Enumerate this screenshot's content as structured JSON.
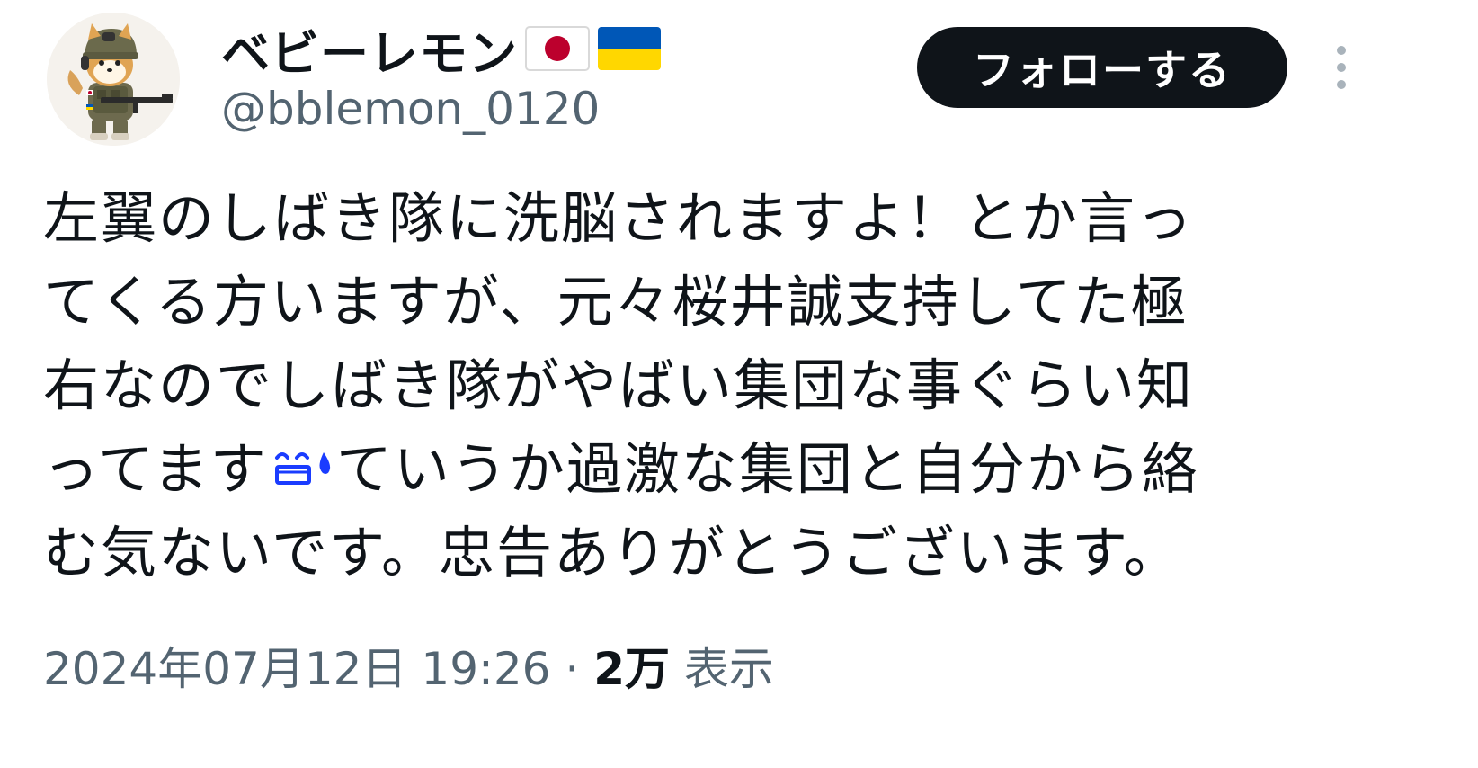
{
  "author": {
    "display_name": "ベビーレモン",
    "flags": [
      "japan-flag",
      "ukraine-flag"
    ],
    "handle": "@bblemon_0120",
    "avatar": "shiba-inu-soldier-avatar"
  },
  "actions": {
    "follow_label": "フォローする",
    "more": "more-options-icon"
  },
  "tweet": {
    "lines": [
      "左翼のしばき隊に洗脳されますよ！とか言っ",
      "てくる方いますが、元々桜井誠支持してた極",
      "右なのでしばき隊がやばい集団な事ぐらい知",
      "ってます",
      "ていうか過激な集団と自分から絡",
      "む気ないです。忠告ありがとうございます。"
    ],
    "emoji": "sweat-face-emoji"
  },
  "meta": {
    "timestamp": "2024年07月12日 19:26",
    "separator": "·",
    "views_count": "2万",
    "views_label": "表示"
  },
  "colors": {
    "text": "#0f1419",
    "secondary": "#536471",
    "button_bg": "#0f1419",
    "button_text": "#ffffff",
    "emoji_blue": "#1a3cff"
  }
}
